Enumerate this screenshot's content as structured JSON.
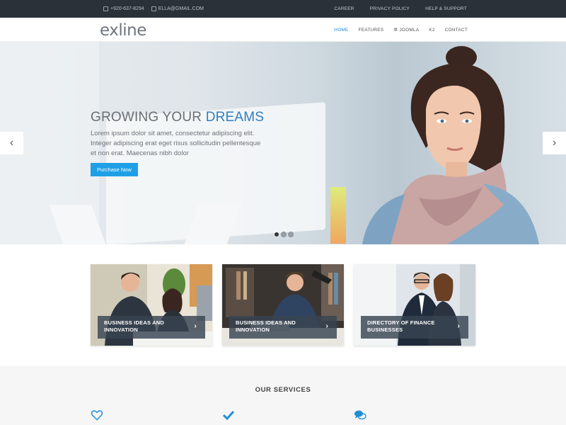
{
  "topbar": {
    "phone": "+920-637-8294",
    "email": "ELLA@GMAIL.COM",
    "links": [
      "CAREER",
      "PRIVACY POLICY",
      "HELP & SUPPORT"
    ]
  },
  "header": {
    "logo": "exline",
    "nav": [
      "HOME",
      "FEATURES",
      "JOOMLA",
      "K2",
      "CONTACT"
    ]
  },
  "hero": {
    "title_main": "GROWING YOUR ",
    "title_accent": "DREAMS",
    "text": "Lorem ipsum dolor sit amet, consectetur adipiscing elit. Integer adipiscing erat eget risus sollicitudin pellentesque et non erat. Maecenas nibh dolor",
    "button": "Purchase Now",
    "prev": "‹",
    "next": "›",
    "slides": 3,
    "active_slide": 1
  },
  "cards": [
    {
      "caption": "BUSINESS IDEAS AND INNOVATION"
    },
    {
      "caption": "BUSINESS IDEAS AND INNOVATION"
    },
    {
      "caption": "DIRECTORY OF FINANCE BUSINESSES"
    }
  ],
  "services": {
    "title": "OUR SERVICES",
    "icons": [
      "heart-icon",
      "check-icon",
      "chat-icon"
    ]
  },
  "colors": {
    "accent": "#1fa0e6",
    "topbar": "#2b3139",
    "caption_bg": "#384452"
  }
}
